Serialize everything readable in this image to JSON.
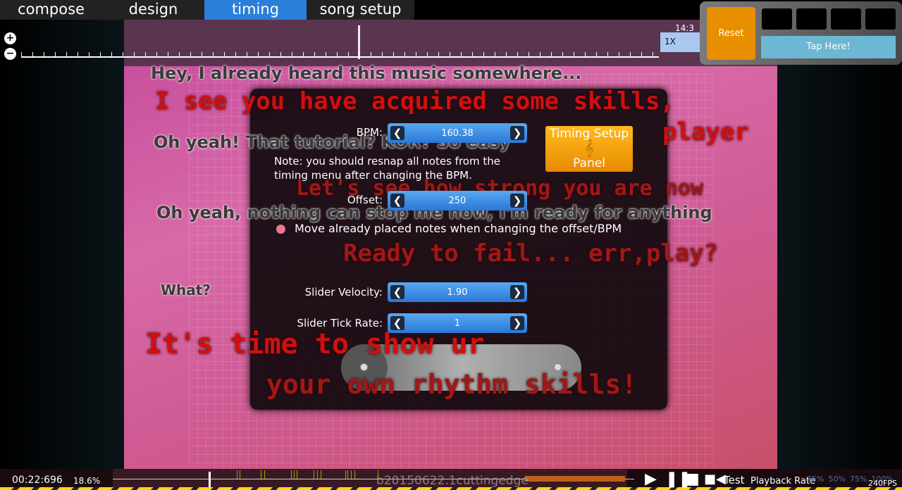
{
  "tabs": [
    "compose",
    "design",
    "timing",
    "song setup"
  ],
  "active_tab": "timing",
  "timeline": {
    "zoom_in": "+",
    "zoom_out": "−",
    "ratio": "14:3",
    "slider_velocity_marker": "1X"
  },
  "top_panel": {
    "reset": "Reset",
    "tap": "Tap Here!"
  },
  "lyrics": [
    "Hey, I already heard this music somewhere...",
    "I see you have acquired some skills,",
    "Oh yeah! That tutorial? KOR? So easy",
    "player",
    "Let's see how strong you are now",
    "Oh yeah, nothing can stop me now, I'm ready for anything",
    "Ready to fail... err,play?",
    "What?",
    "It's time to show ur",
    "your own rhythm skills!"
  ],
  "dialog": {
    "bpm_label": "BPM:",
    "bpm_value": "160.38",
    "note": "Note: you should resnap all notes from the",
    "note2": "timing menu after changing the BPM.",
    "offset_label": "Offset:",
    "offset_value": "250",
    "move_notes": "Move already placed notes when changing the offset/BPM",
    "sv_label": "Slider Velocity:",
    "sv_value": "1.90",
    "tick_label": "Slider Tick Rate:",
    "tick_value": "1",
    "timing_setup_1": "Timing Setup",
    "timing_setup_2": "Panel",
    "arrow_left": "❮",
    "arrow_right": "❯"
  },
  "bottom": {
    "time": "00:22:696",
    "progress": "18.6%",
    "progress_fraction": 0.186,
    "version": "b20150622.1cuttingedge",
    "test": "Test",
    "playback_rate": "Playback Rate",
    "rates": [
      "25%",
      "50%",
      "75%",
      "100%"
    ],
    "fps": "240FPS"
  }
}
